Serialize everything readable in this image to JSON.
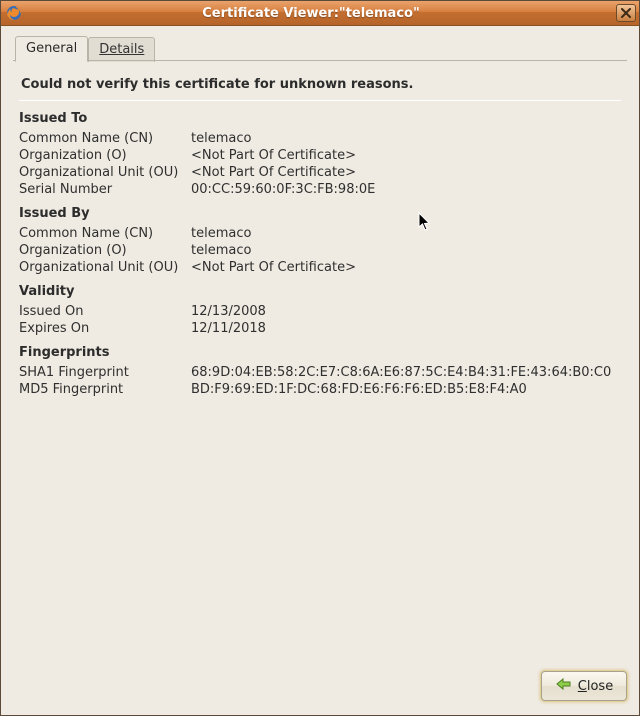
{
  "window": {
    "title": "Certificate Viewer:\"telemaco\"",
    "close_tooltip": "Close"
  },
  "tabs": {
    "general": "General",
    "details": "Details"
  },
  "status": "Could not verify this certificate for unknown reasons.",
  "sections": {
    "issued_to": {
      "title": "Issued To",
      "cn_label": "Common Name (CN)",
      "cn_value": "telemaco",
      "o_label": "Organization (O)",
      "o_value": "<Not Part Of Certificate>",
      "ou_label": "Organizational Unit (OU)",
      "ou_value": "<Not Part Of Certificate>",
      "serial_label": "Serial Number",
      "serial_value": "00:CC:59:60:0F:3C:FB:98:0E"
    },
    "issued_by": {
      "title": "Issued By",
      "cn_label": "Common Name (CN)",
      "cn_value": "telemaco",
      "o_label": "Organization (O)",
      "o_value": "telemaco",
      "ou_label": "Organizational Unit (OU)",
      "ou_value": "<Not Part Of Certificate>"
    },
    "validity": {
      "title": "Validity",
      "issued_label": "Issued On",
      "issued_value": "12/13/2008",
      "expires_label": "Expires On",
      "expires_value": "12/11/2018"
    },
    "fingerprints": {
      "title": "Fingerprints",
      "sha1_label": "SHA1 Fingerprint",
      "sha1_value": "68:9D:04:EB:58:2C:E7:C8:6A:E6:87:5C:E4:B4:31:FE:43:64:B0:C0",
      "md5_label": "MD5 Fingerprint",
      "md5_value": "BD:F9:69:ED:1F:DC:68:FD:E6:F6:F6:ED:B5:E8:F4:A0"
    }
  },
  "buttons": {
    "close": "Close"
  }
}
